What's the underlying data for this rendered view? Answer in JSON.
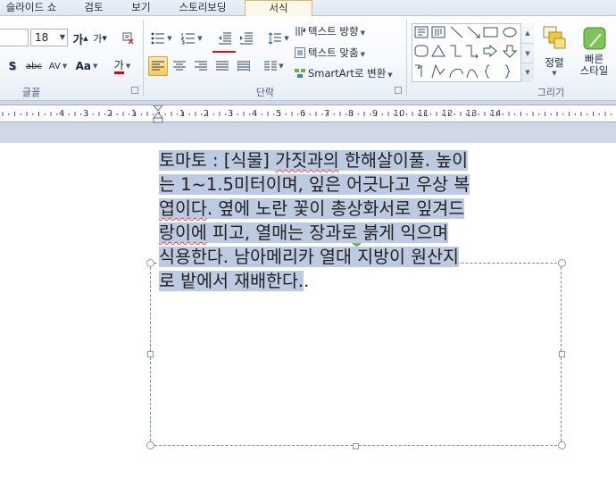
{
  "tabs": [
    {
      "label": "슬라이드 쇼",
      "active": false
    },
    {
      "label": "검토",
      "active": false
    },
    {
      "label": "보기",
      "active": false
    },
    {
      "label": "스토리보딩",
      "active": false
    },
    {
      "label": "서식",
      "active": true
    }
  ],
  "font_group": {
    "label": "글꼴",
    "font_size": "18",
    "grow_label": "가",
    "shrink_label": "가",
    "shadow_label": "S",
    "strike_label": "abc",
    "spacing_label": "AV",
    "case_label": "Aa",
    "color_label": "가",
    "color": "#e00000"
  },
  "paragraph_group": {
    "label": "단락",
    "text_direction": "텍스트 방향",
    "align_text": "텍스트 맞춤",
    "smartart": "SmartArt로 변환"
  },
  "drawing_group": {
    "label": "그리기",
    "arrange": "정렬",
    "quick_styles_line1": "빠른",
    "quick_styles_line2": "스타일"
  },
  "ruler_numbers": [
    "4",
    "3",
    "2",
    "1",
    "1",
    "2",
    "3",
    "4",
    "5",
    "6",
    "7",
    "8",
    "9",
    "10",
    "11",
    "12",
    "13",
    "14"
  ],
  "slide": {
    "lines": [
      [
        "토마토 : [식물] ",
        "가짓과의",
        " 한해살이풀. 높이"
      ],
      [
        "는 1~1.5미터이며, 잎은 어긋나고 우상 복"
      ],
      [
        "",
        "엽이다",
        ". 옆에 노란 꽃이 총상화서로 잎겨드"
      ],
      [
        "",
        "랑이에",
        " 피고, 열매는 장과로 붉게 익으며"
      ],
      [
        "식용한다. 남아메리카 열대 지방이 원산지"
      ],
      [
        "로 밭에서 재배한다."
      ]
    ],
    "tail": "."
  },
  "colors": {
    "selection": "#bccbe1",
    "accent_tab": "#e6b46a",
    "spell_underline": "#e0454a"
  }
}
